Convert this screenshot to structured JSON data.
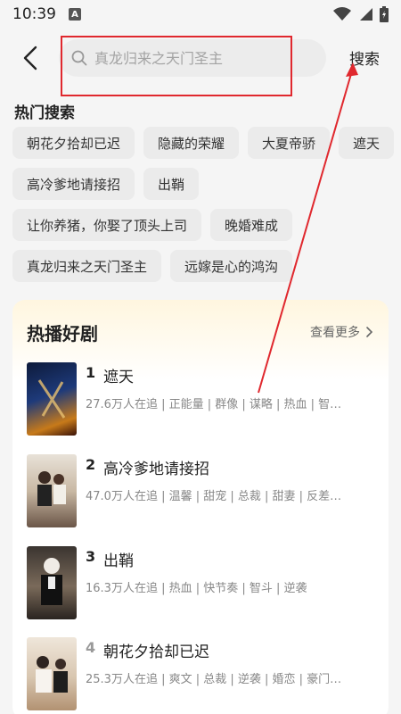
{
  "status_bar": {
    "time": "10:39",
    "notification_letter": "A"
  },
  "header": {
    "search_placeholder": "真龙归来之天门圣主",
    "search_button": "搜索"
  },
  "hot_search": {
    "title": "热门搜索",
    "tags": [
      "朝花夕拾却已迟",
      "隐藏的荣耀",
      "大夏帝骄",
      "遮天",
      "高冷爹地请接招",
      "出鞘",
      "让你养猪，你娶了顶头上司",
      "晚婚难成",
      "真龙归来之天门圣主",
      "远嫁是心的鸿沟"
    ]
  },
  "hot_dramas": {
    "title": "热播好剧",
    "more": "查看更多",
    "items": [
      {
        "rank": "1",
        "name": "遮天",
        "meta": "27.6万人在追 | 正能量 | 群像 | 谋略 | 热血 | 智…"
      },
      {
        "rank": "2",
        "name": "高冷爹地请接招",
        "meta": "47.0万人在追 | 温馨 | 甜宠 | 总裁 | 甜妻 | 反差…"
      },
      {
        "rank": "3",
        "name": "出鞘",
        "meta": "16.3万人在追 | 热血 | 快节奏 | 智斗 | 逆袭"
      },
      {
        "rank": "4",
        "name": "朝花夕拾却已迟",
        "meta": "25.3万人在追 | 爽文 | 总裁 | 逆袭 | 婚恋 | 豪门…"
      }
    ]
  },
  "colors": {
    "annotation_red": "#e0282e",
    "card_gradient_top": "#fff6df"
  }
}
